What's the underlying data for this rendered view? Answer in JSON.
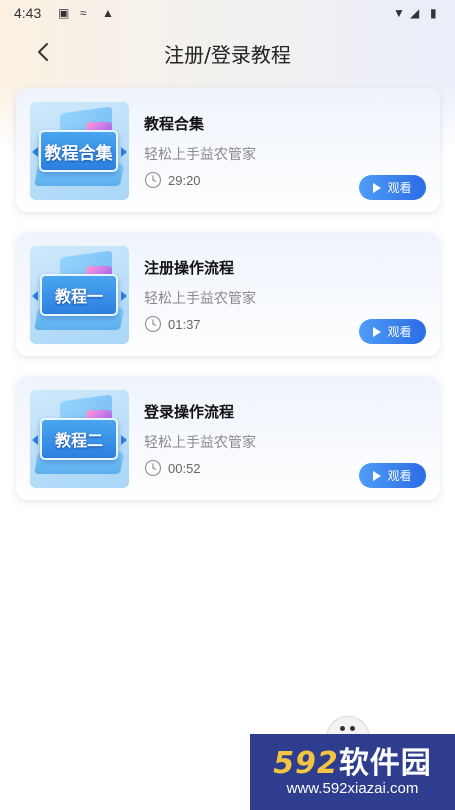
{
  "status_bar": {
    "time": "4:43"
  },
  "header": {
    "title": "注册/登录教程",
    "back_icon": "chevron-left-icon"
  },
  "tutorials": [
    {
      "thumb_text": "教程合集",
      "title": "教程合集",
      "subtitle": "轻松上手益农管家",
      "duration": "29:20",
      "watch_label": "观看"
    },
    {
      "thumb_text": "教程一",
      "title": "注册操作流程",
      "subtitle": "轻松上手益农管家",
      "duration": "01:37",
      "watch_label": "观看"
    },
    {
      "thumb_text": "教程二",
      "title": "登录操作流程",
      "subtitle": "轻松上手益农管家",
      "duration": "00:52",
      "watch_label": "观看"
    }
  ],
  "watermark": {
    "brand_num": "592",
    "brand_text": "软件园",
    "url": "www.592xiazai.com"
  },
  "colors": {
    "accent": "#2a6de6",
    "watermark_bg": "#2f3d8f"
  }
}
